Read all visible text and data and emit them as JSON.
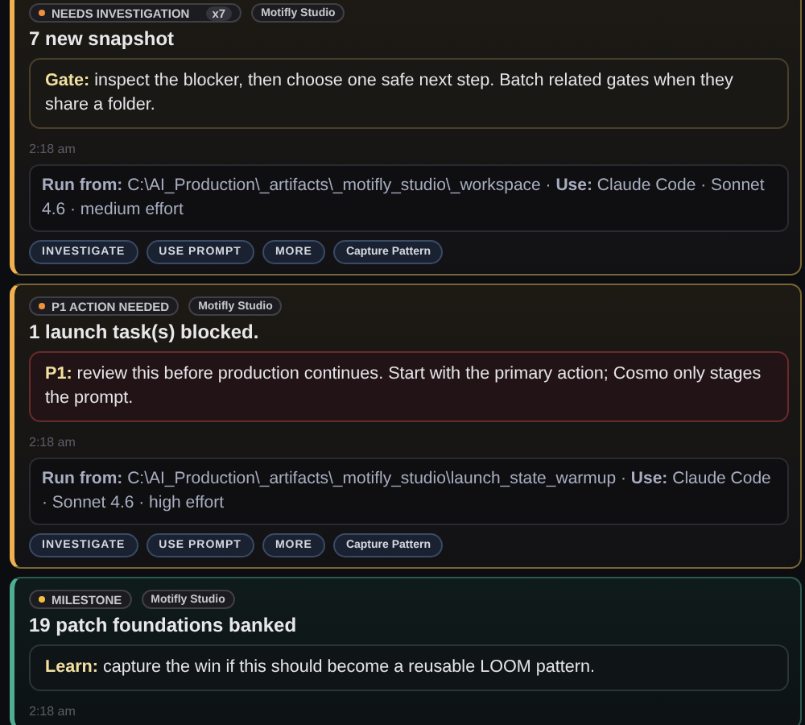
{
  "cards": [
    {
      "kind": "alert",
      "status": {
        "label": "NEEDS INVESTIGATION",
        "color": "#f0903a",
        "count": "x7"
      },
      "project": "Motifly Studio",
      "title": "7 new snapshot",
      "callout": {
        "kind": "gate",
        "text": "**Gate:** inspect the blocker, then choose one safe next step. Batch related gates when they share a folder."
      },
      "time": "2:18 am",
      "run": "**Run from:** C:\\AI_Production\\_artifacts\\_motifly_studio\\_workspace · **Use:** Claude Code · Sonnet 4.6 · medium effort",
      "actions": [
        "INVESTIGATE",
        "USE PROMPT",
        "MORE",
        "Capture Pattern"
      ]
    },
    {
      "kind": "alert",
      "status": {
        "label": "P1 ACTION NEEDED",
        "color": "#f0903a"
      },
      "project": "Motifly Studio",
      "title": "1 launch task(s) blocked.",
      "callout": {
        "kind": "p1",
        "text": "**P1:** review this before production continues. Start with the primary action; Cosmo only stages the prompt."
      },
      "time": "2:18 am",
      "run": "**Run from:** C:\\AI_Production\\_artifacts\\_motifly_studio\\launch_state_warmup · **Use:** Claude Code · Sonnet 4.6 · high effort",
      "actions": [
        "INVESTIGATE",
        "USE PROMPT",
        "MORE",
        "Capture Pattern"
      ]
    },
    {
      "kind": "milestone",
      "status": {
        "label": "MILESTONE",
        "color": "#f0c040"
      },
      "project": "Motifly Studio",
      "title": "19 patch foundations banked",
      "callout": {
        "kind": "learn",
        "text": "**Learn:** capture the win if this should become a reusable LOOM pattern."
      },
      "time": "2:18 am"
    }
  ]
}
